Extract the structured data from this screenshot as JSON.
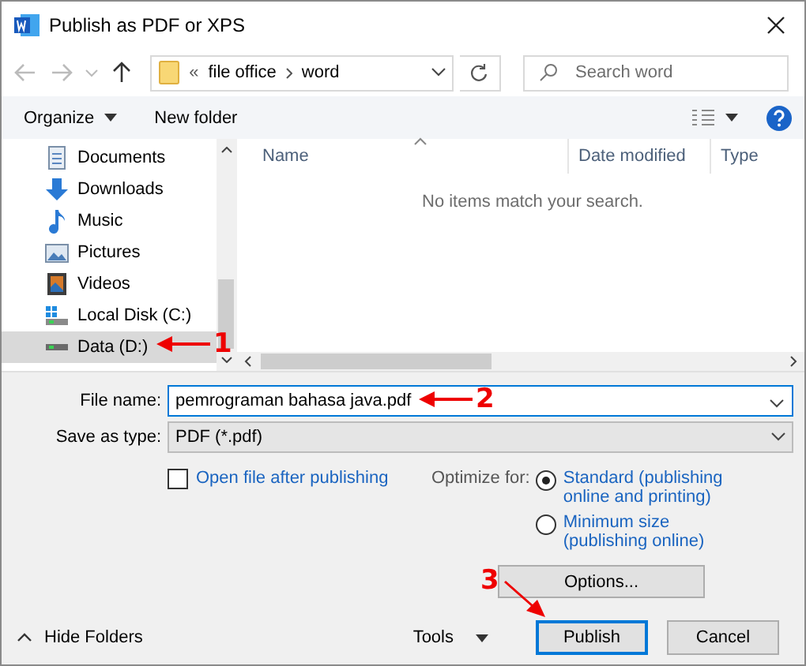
{
  "window": {
    "title": "Publish as PDF or XPS"
  },
  "address": {
    "overflow": "«",
    "path": [
      "file office",
      "word"
    ]
  },
  "search": {
    "placeholder": "Search word"
  },
  "toolbar": {
    "organize": "Organize",
    "new_folder": "New folder"
  },
  "sidebar": {
    "items": [
      {
        "label": "Documents",
        "kind": "documents",
        "selected": false
      },
      {
        "label": "Downloads",
        "kind": "downloads",
        "selected": false
      },
      {
        "label": "Music",
        "kind": "music",
        "selected": false
      },
      {
        "label": "Pictures",
        "kind": "pictures",
        "selected": false
      },
      {
        "label": "Videos",
        "kind": "videos",
        "selected": false
      },
      {
        "label": "Local Disk (C:)",
        "kind": "system-drive",
        "selected": false
      },
      {
        "label": "Data (D:)",
        "kind": "drive",
        "selected": true
      }
    ]
  },
  "file_list": {
    "columns": [
      "Name",
      "Date modified",
      "Type"
    ],
    "empty_message": "No items match your search."
  },
  "form": {
    "file_name": {
      "label": "File name:",
      "value": "pemrograman bahasa java.pdf"
    },
    "save_type": {
      "label": "Save as type:",
      "value": "PDF (*.pdf)"
    }
  },
  "open_after": {
    "label": "Open file after publishing",
    "checked": false
  },
  "optimize": {
    "label": "Optimize for:",
    "options": [
      {
        "label": "Standard (publishing online and printing)",
        "selected": true
      },
      {
        "label": "Minimum size (publishing online)",
        "selected": false
      }
    ]
  },
  "options_button": "Options...",
  "hide_folders": "Hide Folders",
  "tools": "Tools",
  "buttons": [
    {
      "label": "Publish",
      "default": true
    },
    {
      "label": "Cancel",
      "default": false
    }
  ],
  "annotations": [
    {
      "label": "1"
    },
    {
      "label": "2"
    },
    {
      "label": "3"
    }
  ]
}
